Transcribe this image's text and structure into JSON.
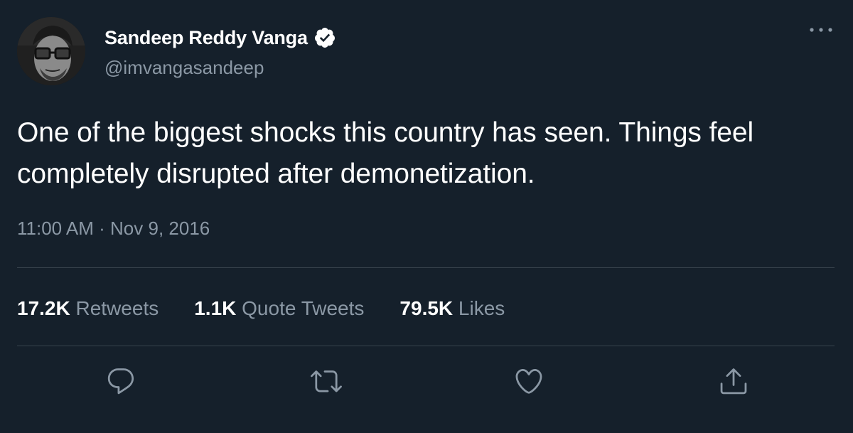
{
  "author": {
    "display_name": "Sandeep Reddy Vanga",
    "handle": "@imvangasandeep",
    "verified": true
  },
  "tweet": {
    "text": "One of the biggest shocks this country has seen. Things feel completely disrupted after demonetization.",
    "timestamp": "11:00 AM · Nov 9, 2016"
  },
  "stats": {
    "retweets": {
      "count": "17.2K",
      "label": "Retweets"
    },
    "quote_tweets": {
      "count": "1.1K",
      "label": "Quote Tweets"
    },
    "likes": {
      "count": "79.5K",
      "label": "Likes"
    }
  },
  "actions": {
    "reply": {
      "icon": "reply-icon"
    },
    "retweet": {
      "icon": "retweet-icon"
    },
    "like": {
      "icon": "heart-icon"
    },
    "share": {
      "icon": "share-icon"
    }
  },
  "colors": {
    "background": "#15202b",
    "text_primary": "#ffffff",
    "text_secondary": "#8b98a5",
    "divider": "#38444d",
    "verified_badge": "#ffffff"
  }
}
